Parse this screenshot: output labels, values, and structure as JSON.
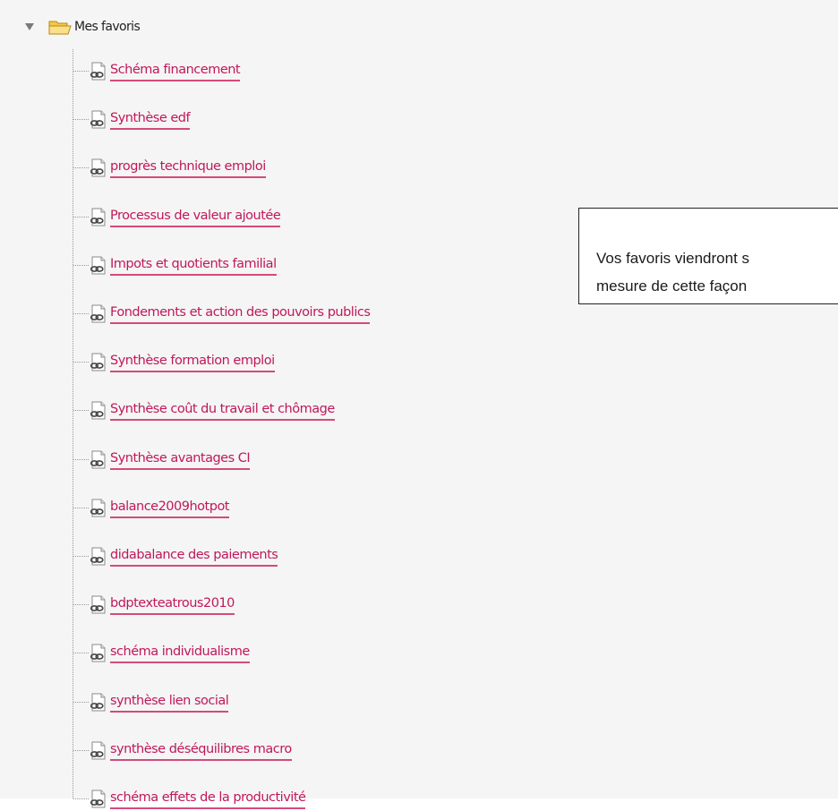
{
  "tree": {
    "root": {
      "label": "Mes favoris",
      "expanded": true,
      "icon": "folder-open-icon"
    },
    "items": [
      {
        "label": "Schéma financement"
      },
      {
        "label": "Synthèse edf"
      },
      {
        "label": "progrès technique emploi"
      },
      {
        "label": "Processus de valeur ajoutée"
      },
      {
        "label": "Impots et quotients familial"
      },
      {
        "label": "Fondements et action des pouvoirs publics"
      },
      {
        "label": "Synthèse formation emploi"
      },
      {
        "label": "Synthèse coût du travail et chômage"
      },
      {
        "label": "Synthèse avantages CI"
      },
      {
        "label": "balance2009hotpot"
      },
      {
        "label": "didabalance des paiements"
      },
      {
        "label": "bdptexteatrous2010"
      },
      {
        "label": "schéma individualisme"
      },
      {
        "label": "synthèse lien social"
      },
      {
        "label": "synthèse déséquilibres macro"
      },
      {
        "label": "schéma effets de la productivité"
      }
    ],
    "item_icon": "link-document-icon",
    "link_color": "#c0185a"
  },
  "callout": {
    "text": "Vos favoris viendront s\nmesure de cette façon"
  }
}
